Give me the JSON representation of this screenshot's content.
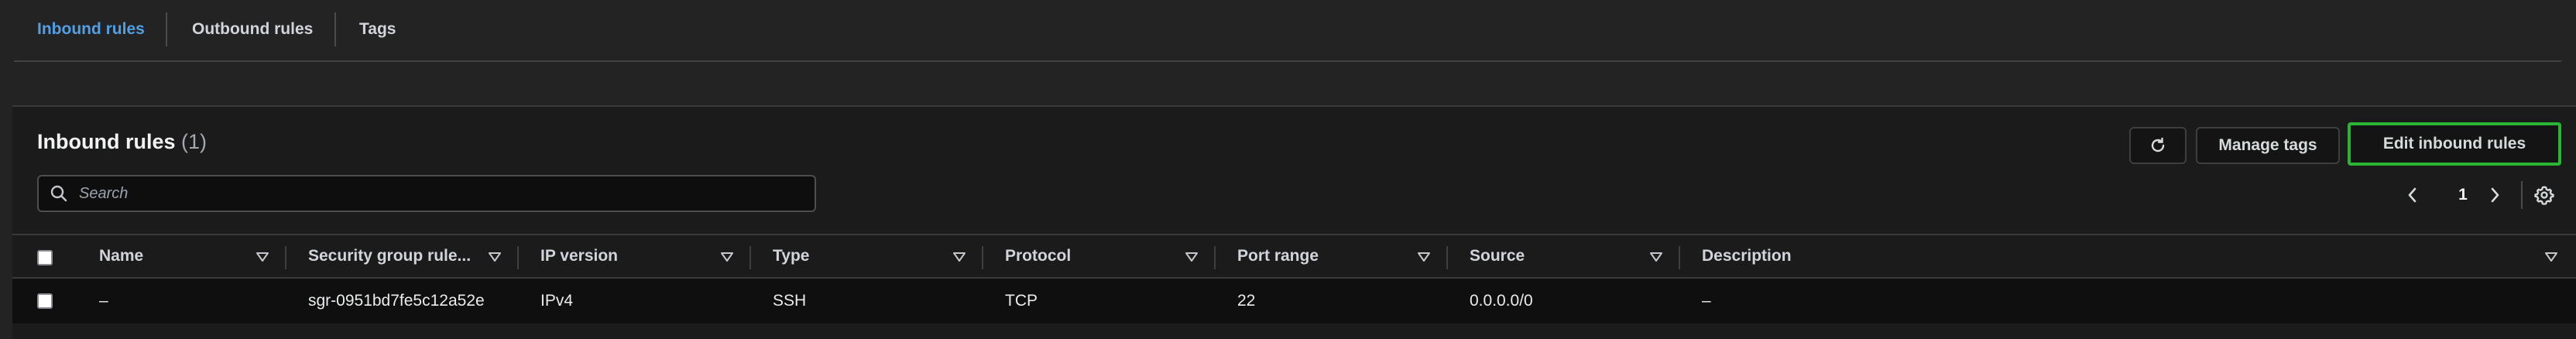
{
  "tabs": [
    {
      "label": "Inbound rules",
      "active": true
    },
    {
      "label": "Outbound rules",
      "active": false
    },
    {
      "label": "Tags",
      "active": false
    }
  ],
  "panel": {
    "title": "Inbound rules",
    "count": "(1)",
    "refresh_icon": "refresh-icon",
    "manage_tags_label": "Manage tags",
    "edit_label": "Edit inbound rules"
  },
  "search": {
    "placeholder": "Search",
    "value": ""
  },
  "pagination": {
    "page": "1",
    "prev_icon": "chevron-left-icon",
    "next_icon": "chevron-right-icon",
    "settings_icon": "gear-icon"
  },
  "table": {
    "headers": [
      "Name",
      "Security group rule...",
      "IP version",
      "Type",
      "Protocol",
      "Port range",
      "Source",
      "Description"
    ],
    "rows": [
      {
        "name": "–",
        "rule_id": "sgr-0951bd7fe5c12a52e",
        "ip_version": "IPv4",
        "type": "SSH",
        "protocol": "TCP",
        "port_range": "22",
        "source": "0.0.0.0/0",
        "description": "–"
      }
    ]
  },
  "colors": {
    "background": "#232323",
    "panel": "#1b1b1b",
    "active_tab": "#539fe5",
    "focus_outline": "#2bb534"
  }
}
